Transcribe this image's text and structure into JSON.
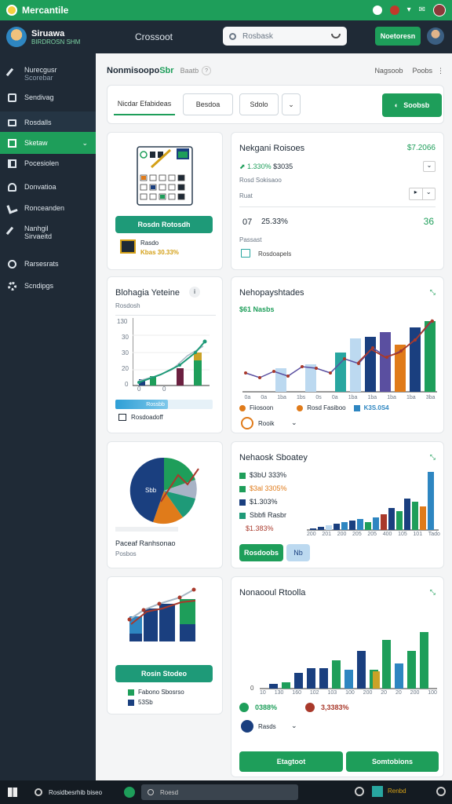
{
  "topbar": {
    "title": "Mercantile"
  },
  "appbar": {
    "brand_name": "Siruawa",
    "brand_sub": "BIRDROSN SHM",
    "section": "Crossoot",
    "search_placeholder": "Rosbask",
    "top_button": "Noetoresn"
  },
  "sidebar": {
    "items": [
      {
        "label": "Nurecgusr",
        "sub": "Scorebar",
        "icon": "wrench-icon"
      },
      {
        "label": "Sendivag",
        "icon": "briefcase-icon"
      },
      {
        "label": "Rosdalls",
        "icon": "monitor-icon"
      },
      {
        "label": "Sketaw",
        "icon": "square-icon"
      },
      {
        "label": "Pocesiolen",
        "icon": "grid-icon"
      },
      {
        "label": "Donvatioa",
        "icon": "download-icon"
      },
      {
        "label": "Ronceanden",
        "icon": "tools-icon"
      },
      {
        "label": "Nanhgil",
        "sub": "Sirvaeitd",
        "icon": "wrench-icon"
      },
      {
        "label": "Rarsesrats",
        "icon": "circle-icon"
      },
      {
        "label": "Scndipgs",
        "icon": "gear-icon"
      }
    ]
  },
  "header": {
    "title": "Nonmisoopo",
    "title_accent": "Sbr",
    "sub": "Baatb",
    "right_a": "Nagsoob",
    "right_b": "Poobs"
  },
  "tabs": {
    "first": "Nicdar Efabideas",
    "second": "Besdoa",
    "third": "Sdolo",
    "action": "Soobsb"
  },
  "card_calendar": {
    "button": "Rosdn Rotosdh",
    "legend_label": "Rasdo",
    "legend_value": "Kbas 30.33%"
  },
  "card_metrics": {
    "title": "Nekgani Roisoes",
    "value_top": "$7.2066",
    "row_value_a": "1.330%",
    "row_value_b": "$3035",
    "row_label": "Rosd Sokisaoo",
    "row2_label": "Ruat",
    "big_value_a": "07",
    "big_value_b": "25.33%",
    "big_value_c": "36",
    "small_label": "Passast",
    "footer_label": "Rosdoapels"
  },
  "card_line": {
    "title": "Blohagia Yeteine",
    "sub": "Rosdosh",
    "y_ticks": [
      "130",
      "30",
      "30",
      "20",
      "0"
    ],
    "x_ticks": [
      "0",
      "0"
    ],
    "bar_label": "Rossbb",
    "footer_label": "Rosdoadoff"
  },
  "card_bar_line": {
    "title": "Nehopayshtades",
    "sub_value": "$61 Nasbs",
    "legend": [
      "Fiiosoon",
      "Rosd Fasiboo",
      "K3S.0S4"
    ],
    "footer_label": "Rooik",
    "colors": {
      "green": "#1e9e5a",
      "blue": "#1a3f7f",
      "light": "#bcd9f0",
      "orange": "#e07b1a",
      "purple": "#5a4fa0",
      "teal": "#28a6a0",
      "red": "#a9392b"
    }
  },
  "card_pie": {
    "slice_label": "Sbb",
    "title": "Paceaf Ranhsonao",
    "sub": "Posbos"
  },
  "card_bars2": {
    "title": "Nehaosk Sboatey",
    "legend": [
      "$3bU 333%",
      "$3al 3305%",
      "$1.303%",
      "Sbbfi Rasbr",
      "$1.383%"
    ],
    "x_ticks": [
      "200",
      "201",
      "200",
      "205",
      "205",
      "400",
      "105",
      "101",
      "Tado"
    ],
    "btn_primary": "Rosdoobs",
    "btn_secondary": "Nb"
  },
  "card_bars3": {
    "button": "Rosin Stodeo",
    "legend": [
      "Fabono Sbosrso",
      "53Sb"
    ]
  },
  "card_bars4": {
    "title": "Nonaooul Rtoolla",
    "x_ticks": [
      "10",
      "130",
      "160",
      "102",
      "103",
      "100",
      "200",
      "20",
      "20",
      "200",
      "100"
    ],
    "legend_a": "0388%",
    "legend_b": "3,3383%",
    "footer_label": "Rasds",
    "btn_left": "Etagtoot",
    "btn_right": "Somtobions"
  },
  "taskbar": {
    "app_label": "Rosidbesrhib biseo",
    "search": "Roesd",
    "right_label": "Renbd"
  }
}
